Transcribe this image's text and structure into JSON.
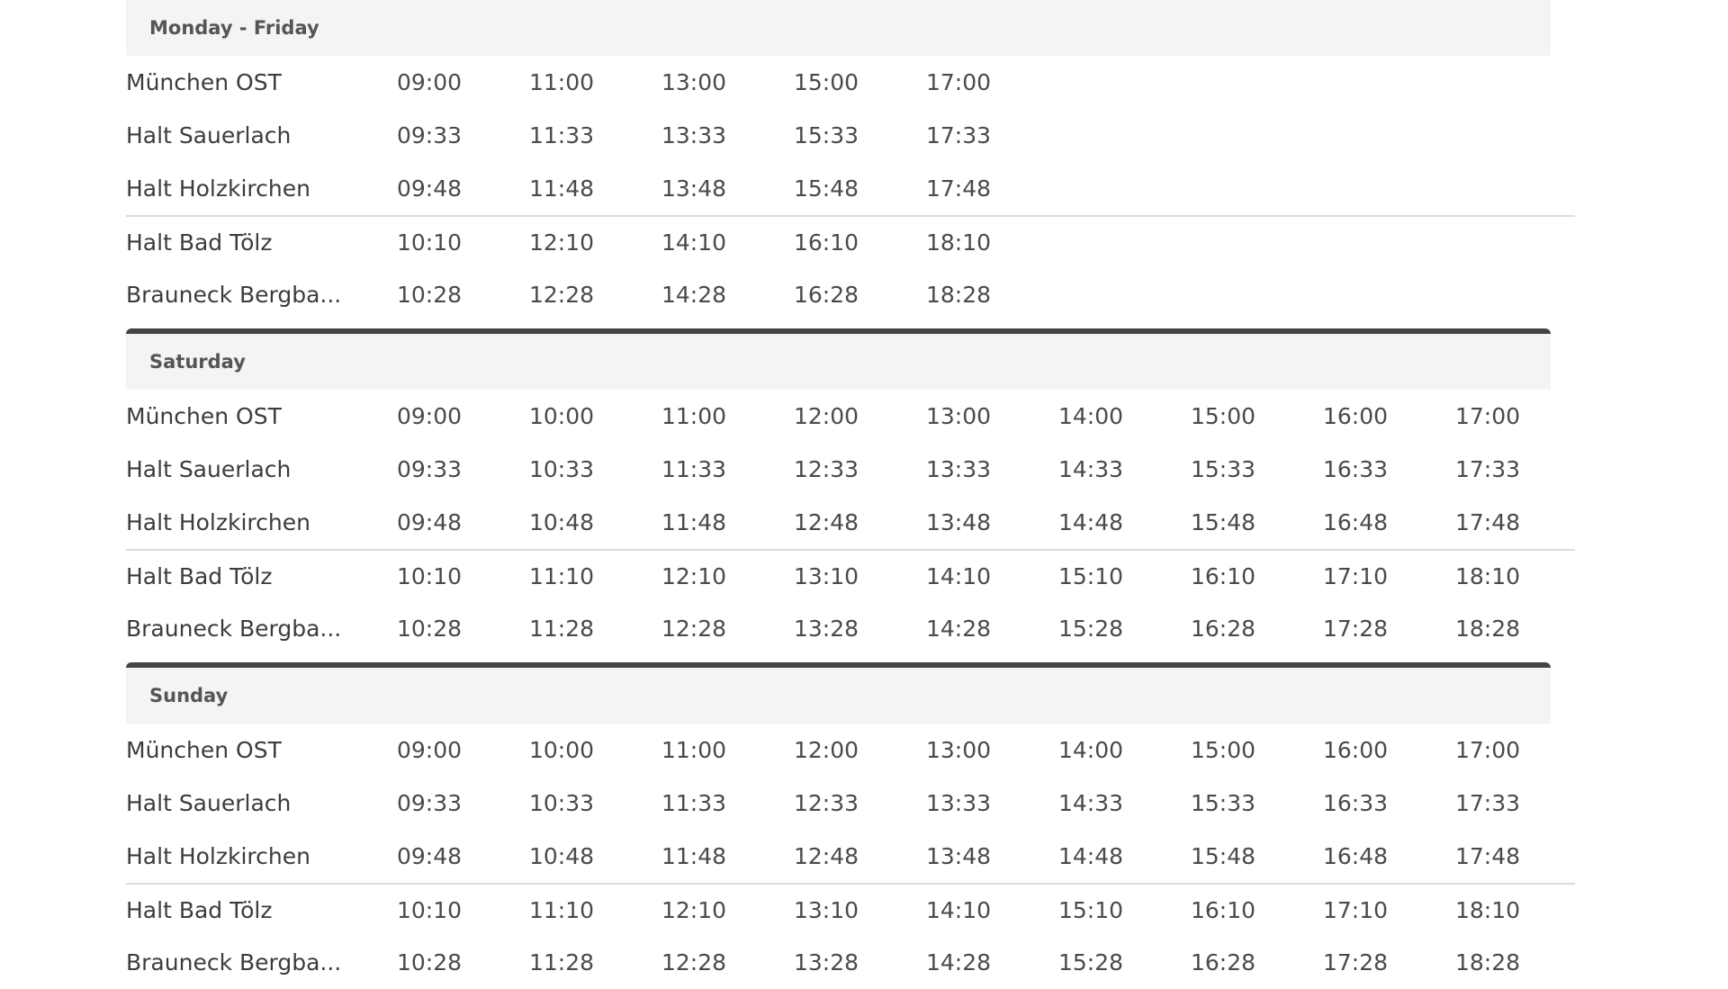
{
  "sections": [
    {
      "title": "Monday - Friday",
      "rows": [
        {
          "stop": "München OST",
          "times": [
            "09:00",
            "11:00",
            "13:00",
            "15:00",
            "17:00",
            "",
            "",
            "",
            ""
          ]
        },
        {
          "stop": "Halt Sauerlach",
          "times": [
            "09:33",
            "11:33",
            "13:33",
            "15:33",
            "17:33",
            "",
            "",
            "",
            ""
          ]
        },
        {
          "stop": "Halt Holzkirchen",
          "times": [
            "09:48",
            "11:48",
            "13:48",
            "15:48",
            "17:48",
            "",
            "",
            "",
            ""
          ]
        },
        {
          "stop": "Halt Bad Tölz",
          "times": [
            "10:10",
            "12:10",
            "14:10",
            "16:10",
            "18:10",
            "",
            "",
            "",
            ""
          ]
        },
        {
          "stop": "Brauneck Bergba...",
          "times": [
            "10:28",
            "12:28",
            "14:28",
            "16:28",
            "18:28",
            "",
            "",
            "",
            ""
          ]
        }
      ]
    },
    {
      "title": "Saturday",
      "rows": [
        {
          "stop": "München OST",
          "times": [
            "09:00",
            "10:00",
            "11:00",
            "12:00",
            "13:00",
            "14:00",
            "15:00",
            "16:00",
            "17:00"
          ]
        },
        {
          "stop": "Halt Sauerlach",
          "times": [
            "09:33",
            "10:33",
            "11:33",
            "12:33",
            "13:33",
            "14:33",
            "15:33",
            "16:33",
            "17:33"
          ]
        },
        {
          "stop": "Halt Holzkirchen",
          "times": [
            "09:48",
            "10:48",
            "11:48",
            "12:48",
            "13:48",
            "14:48",
            "15:48",
            "16:48",
            "17:48"
          ]
        },
        {
          "stop": "Halt Bad Tölz",
          "times": [
            "10:10",
            "11:10",
            "12:10",
            "13:10",
            "14:10",
            "15:10",
            "16:10",
            "17:10",
            "18:10"
          ]
        },
        {
          "stop": "Brauneck Bergba...",
          "times": [
            "10:28",
            "11:28",
            "12:28",
            "13:28",
            "14:28",
            "15:28",
            "16:28",
            "17:28",
            "18:28"
          ]
        }
      ]
    },
    {
      "title": "Sunday",
      "rows": [
        {
          "stop": "München OST",
          "times": [
            "09:00",
            "10:00",
            "11:00",
            "12:00",
            "13:00",
            "14:00",
            "15:00",
            "16:00",
            "17:00"
          ]
        },
        {
          "stop": "Halt Sauerlach",
          "times": [
            "09:33",
            "10:33",
            "11:33",
            "12:33",
            "13:33",
            "14:33",
            "15:33",
            "16:33",
            "17:33"
          ]
        },
        {
          "stop": "Halt Holzkirchen",
          "times": [
            "09:48",
            "10:48",
            "11:48",
            "12:48",
            "13:48",
            "14:48",
            "15:48",
            "16:48",
            "17:48"
          ]
        },
        {
          "stop": "Halt Bad Tölz",
          "times": [
            "10:10",
            "11:10",
            "12:10",
            "13:10",
            "14:10",
            "15:10",
            "16:10",
            "17:10",
            "18:10"
          ]
        },
        {
          "stop": "Brauneck Bergba...",
          "times": [
            "10:28",
            "11:28",
            "12:28",
            "13:28",
            "14:28",
            "15:28",
            "16:28",
            "17:28",
            "18:28"
          ]
        }
      ]
    }
  ],
  "colors": {
    "header_bg": "#f4f4f4",
    "section_bar": "#444444",
    "divider": "#dcdcdc",
    "text": "#3c3c3c"
  }
}
